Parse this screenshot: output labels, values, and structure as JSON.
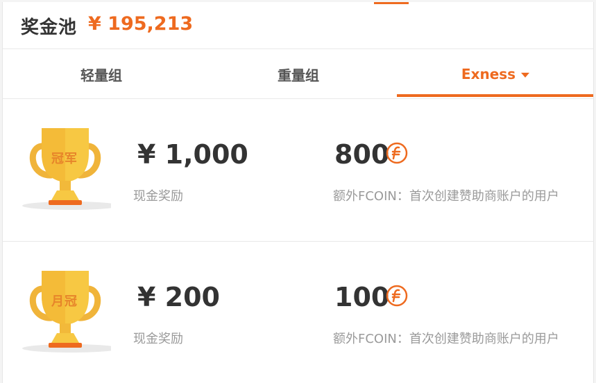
{
  "header": {
    "title": "奖金池",
    "amount": "¥ 195,213"
  },
  "tabs": [
    {
      "label": "轻量组",
      "active": false
    },
    {
      "label": "重量组",
      "active": false
    },
    {
      "label": "Exness",
      "active": true
    }
  ],
  "prizes": [
    {
      "trophy_text": "冠军",
      "cash_amount": "¥ 1,000",
      "cash_label": "现金奖励",
      "fcoin_amount": "800",
      "fcoin_note": "额外FCOIN：首次创建赞助商账户的用户"
    },
    {
      "trophy_text": "月冠",
      "cash_amount": "¥ 200",
      "cash_label": "现金奖励",
      "fcoin_amount": "100",
      "fcoin_note": "额外FCOIN：首次创建赞助商账户的用户"
    }
  ],
  "colors": {
    "accent": "#ee6a1f",
    "trophy": "#f7c843",
    "text": "#333333",
    "muted": "#9a9a9a"
  },
  "icons": {
    "fcoin": "fcoin-icon",
    "trophy": "trophy-icon",
    "caret": "caret-down-icon"
  }
}
